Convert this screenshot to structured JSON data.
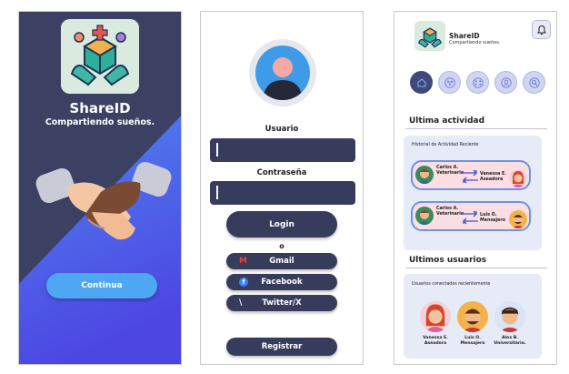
{
  "welcome": {
    "title": "ShareID",
    "subtitle": "Compartiendo sueños.",
    "continue_label": "Continua",
    "colors": {
      "bg_dark": "#3c4163",
      "bg_blue": "#4a5fe0",
      "accent": "#4ea7f3"
    }
  },
  "login": {
    "user_label": "Usuario",
    "password_label": "Contraseña",
    "login_button": "Login",
    "or_text": "o",
    "gmail_button": "Gmail",
    "facebook_button": "Facebook",
    "twitter_button": "Twitter/X",
    "register_button": "Registrar",
    "icons": {
      "gmail": "M",
      "facebook": "f",
      "twitter": "\\"
    }
  },
  "dashboard": {
    "app_name": "ShareID",
    "tagline": "Compartiendo sueños.",
    "nav_icons": [
      "home-icon",
      "group-icon",
      "community-icon",
      "profile-icon",
      "search-icon"
    ],
    "activity_title": "Ultima actividad",
    "activity_card_title": "Historial de Actividad Reciente",
    "activities": [
      {
        "from": "Carlos A.",
        "from_role": "Veterinario",
        "to": "Vanessa E.",
        "to_role": "Aseadora"
      },
      {
        "from": "Carlos A.",
        "from_role": "Veterinario",
        "to": "Luis O.",
        "to_role": "Mensajero"
      }
    ],
    "users_title": "Ultimos usuarios",
    "users_card_title": "Usuarios conectados recientemente",
    "users": [
      {
        "name": "Vanessa E.",
        "role": "Aseadora"
      },
      {
        "name": "Luis O.",
        "role": "Mensajero"
      },
      {
        "name": "Alex B.",
        "role": "Universitario."
      }
    ]
  }
}
